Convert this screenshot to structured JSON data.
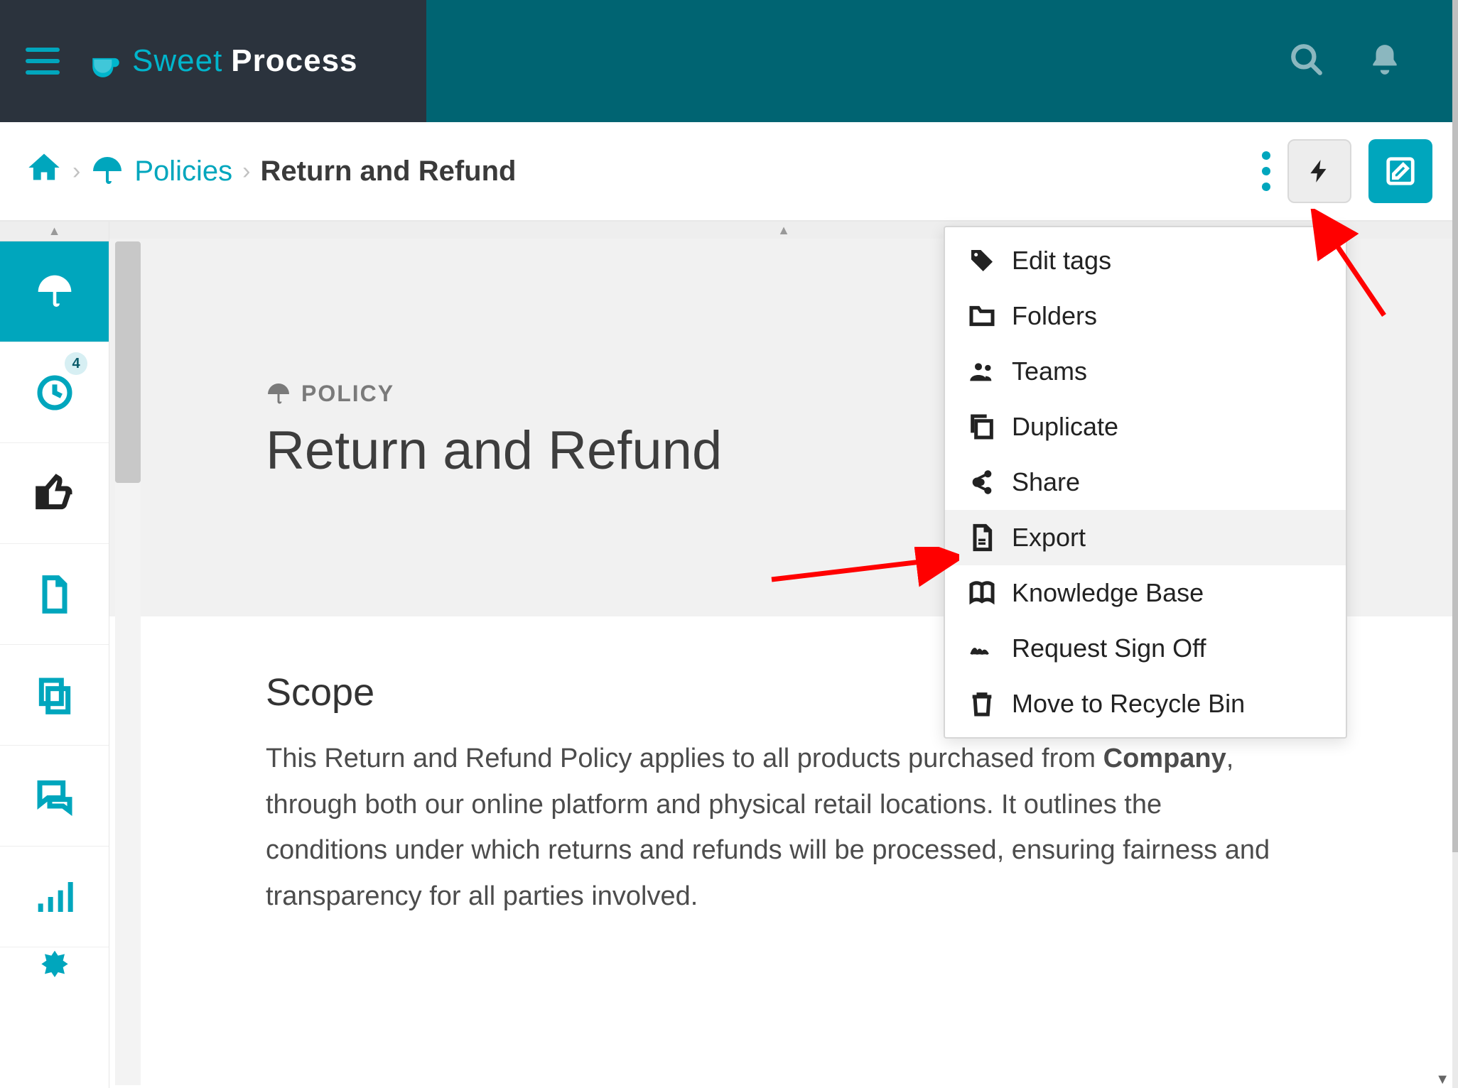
{
  "app": {
    "logo_text_a": "Sweet",
    "logo_text_b": "Process"
  },
  "breadcrumb": {
    "policies_label": "Policies",
    "current_label": "Return and Refund"
  },
  "sidebar": {
    "badge_count": "4"
  },
  "hero": {
    "eyebrow": "POLICY",
    "title": "Return and Refund"
  },
  "scope": {
    "heading": "Scope",
    "text_a": "This Return and Refund Policy applies to all products purchased from ",
    "bold": "Company",
    "text_b": ", through both our online platform and physical retail locations. It outlines the conditions under which returns and refunds will be processed, ensuring fairness and transparency for all parties involved."
  },
  "menu": {
    "edit_tags": "Edit tags",
    "folders": "Folders",
    "teams": "Teams",
    "duplicate": "Duplicate",
    "share": "Share",
    "export": "Export",
    "knowledge_base": "Knowledge Base",
    "request_sign_off": "Request Sign Off",
    "move_recycle": "Move to Recycle Bin"
  }
}
